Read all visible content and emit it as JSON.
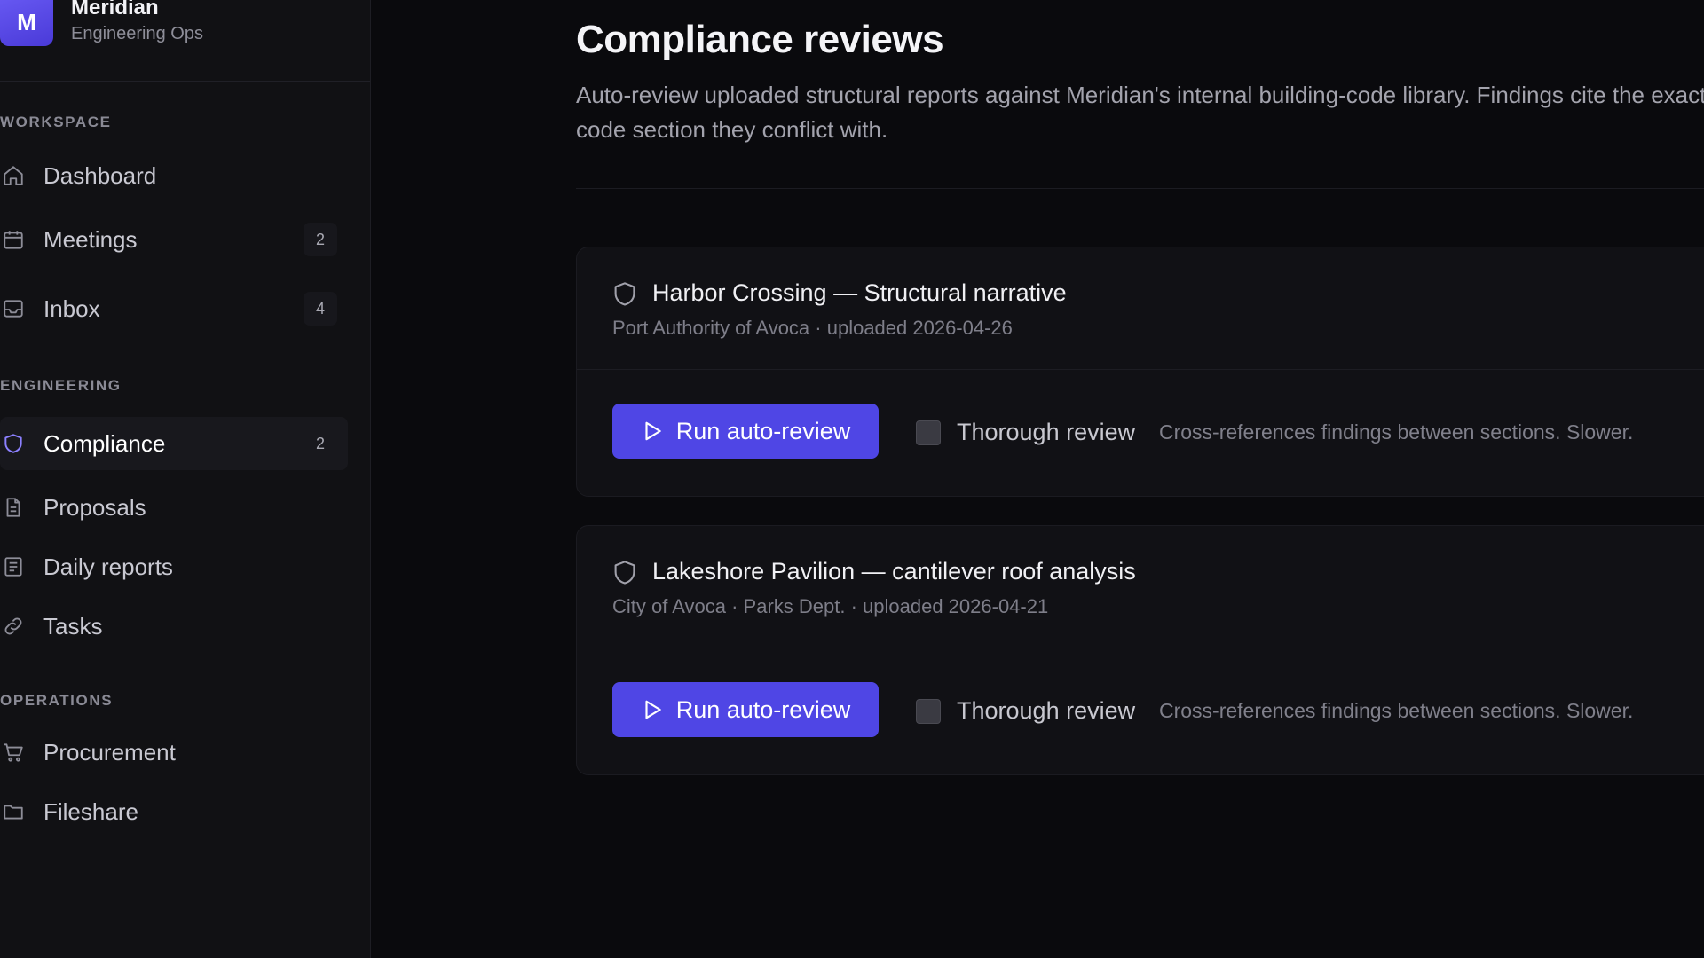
{
  "brand": {
    "logo_letter": "M",
    "name": "Meridian",
    "subtitle": "Engineering Ops"
  },
  "sidebar": {
    "sections": [
      {
        "label": "WORKSPACE"
      },
      {
        "label": "ENGINEERING"
      },
      {
        "label": "OPERATIONS"
      }
    ],
    "items": [
      {
        "label": "Dashboard",
        "icon": "home-icon"
      },
      {
        "label": "Meetings",
        "icon": "calendar-icon",
        "badge": "2"
      },
      {
        "label": "Inbox",
        "icon": "inbox-icon",
        "badge": "4"
      },
      {
        "label": "Compliance",
        "icon": "shield-icon",
        "badge": "2",
        "active": true
      },
      {
        "label": "Proposals",
        "icon": "document-icon"
      },
      {
        "label": "Daily reports",
        "icon": "report-icon"
      },
      {
        "label": "Tasks",
        "icon": "link-icon"
      },
      {
        "label": "Procurement",
        "icon": "cart-icon"
      },
      {
        "label": "Fileshare",
        "icon": "folder-icon"
      }
    ]
  },
  "main": {
    "title": "Compliance reviews",
    "description": "Auto-review uploaded structural reports against Meridian's internal building-code library. Findings cite the exact code section they conflict with.",
    "reviews": [
      {
        "title": "Harbor Crossing — Structural narrative",
        "meta": "Port Authority of Avoca · uploaded 2026-04-26",
        "run_label": "Run auto-review",
        "thorough_label": "Thorough review",
        "thorough_checked": false,
        "hint": "Cross-references findings between sections. Slower."
      },
      {
        "title": "Lakeshore Pavilion — cantilever roof analysis",
        "meta": "City of Avoca · Parks Dept. · uploaded 2026-04-21",
        "run_label": "Run auto-review",
        "thorough_label": "Thorough review",
        "thorough_checked": false,
        "hint": "Cross-references findings between sections. Slower."
      }
    ]
  },
  "colors": {
    "accent": "#4f46e5",
    "active_icon": "#8c80ff",
    "background": "#0a0a0d",
    "sidebar": "#111114"
  }
}
